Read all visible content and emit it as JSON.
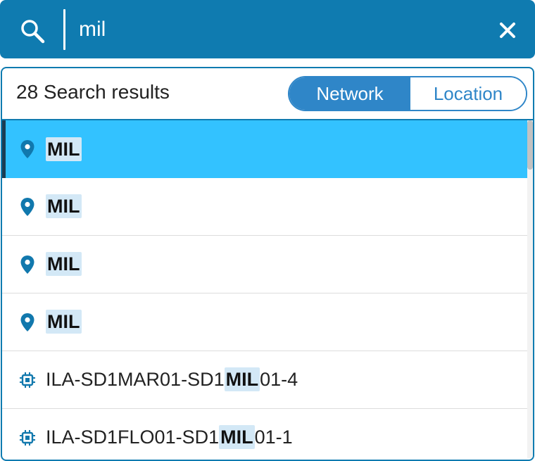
{
  "search": {
    "value": "mil",
    "clear_icon": "close-icon",
    "search_icon": "search-icon"
  },
  "results": {
    "count_label": "28 Search results",
    "toggle": {
      "network_label": "Network",
      "location_label": "Location",
      "active": "Network"
    },
    "items": [
      {
        "icon": "location-pin-icon",
        "prefix": "",
        "match": "MIL",
        "suffix": "",
        "selected": true
      },
      {
        "icon": "location-pin-icon",
        "prefix": "",
        "match": "MIL",
        "suffix": "",
        "selected": false
      },
      {
        "icon": "location-pin-icon",
        "prefix": "",
        "match": "MIL",
        "suffix": "",
        "selected": false
      },
      {
        "icon": "location-pin-icon",
        "prefix": "",
        "match": "MIL",
        "suffix": "",
        "selected": false
      },
      {
        "icon": "chip-icon",
        "prefix": "ILA-SD1MAR01-SD1",
        "match": "MIL",
        "suffix": "01-4",
        "selected": false
      },
      {
        "icon": "chip-icon",
        "prefix": "ILA-SD1FLO01-SD1",
        "match": "MIL",
        "suffix": "01-1",
        "selected": false
      }
    ]
  },
  "colors": {
    "header_bg": "#0f7bb0",
    "toggle_active": "#2f86c8",
    "selected_row": "#33c2ff",
    "highlight": "#d3e8f6"
  }
}
